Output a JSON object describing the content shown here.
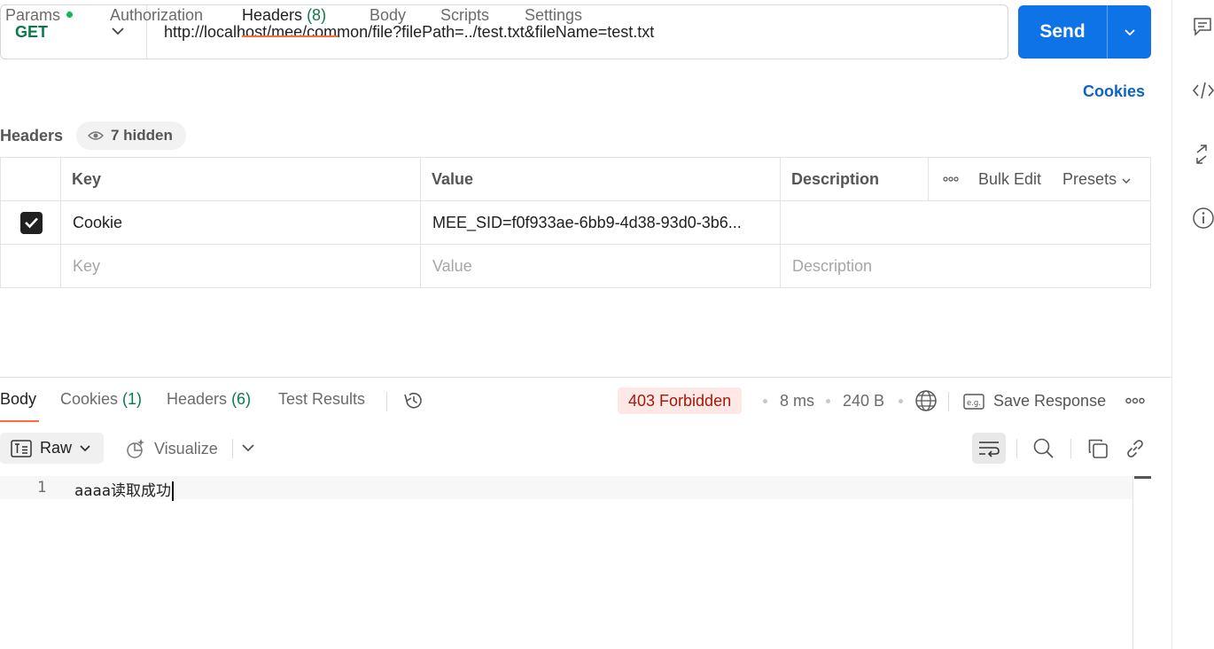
{
  "request": {
    "method": "GET",
    "url": "http://localhost/mee/common/file?filePath=../test.txt&fileName=test.txt",
    "send_label": "Send"
  },
  "request_tabs": [
    {
      "label": "Params",
      "count": ""
    },
    {
      "label": "Authorization",
      "count": ""
    },
    {
      "label": "Headers",
      "count": "(8)"
    },
    {
      "label": "Body",
      "count": ""
    },
    {
      "label": "Scripts",
      "count": ""
    },
    {
      "label": "Settings",
      "count": ""
    }
  ],
  "cookies_link": "Cookies",
  "headers_section": {
    "title": "Headers",
    "hidden_label": "7 hidden",
    "columns": {
      "key": "Key",
      "value": "Value",
      "description": "Description"
    },
    "bulk_edit": "Bulk Edit",
    "presets": "Presets",
    "rows": [
      {
        "checked": true,
        "key": "Cookie",
        "value": "MEE_SID=f0f933ae-6bb9-4d38-93d0-3b6...",
        "description": ""
      }
    ],
    "placeholder": {
      "key": "Key",
      "value": "Value",
      "description": "Description"
    }
  },
  "response_tabs": [
    {
      "label": "Body",
      "count": ""
    },
    {
      "label": "Cookies",
      "count": "(1)"
    },
    {
      "label": "Headers",
      "count": "(6)"
    },
    {
      "label": "Test Results",
      "count": ""
    }
  ],
  "response_meta": {
    "status": "403 Forbidden",
    "time": "8 ms",
    "size": "240 B",
    "save_label": "Save Response",
    "status_bg": "#fde8e6",
    "status_color": "#a11a0e"
  },
  "response_toolbar": {
    "format": "Raw",
    "visualize": "Visualize"
  },
  "response_body": {
    "lines": [
      {
        "number": "1",
        "text": "aaaa读取成功"
      }
    ]
  },
  "colors": {
    "accent": "#ff6c37",
    "send": "#0d73e6",
    "method": "#0b7a4b",
    "link": "#0d63c6"
  },
  "icons": [
    "chevron-down-icon",
    "eye-icon",
    "check-icon",
    "ellipsis-icon",
    "history-icon",
    "globe-icon",
    "eg-icon",
    "format-icon",
    "magic-wand-icon",
    "wrap-lines-icon",
    "search-icon",
    "copy-icon",
    "link-icon",
    "comment-icon",
    "code-icon",
    "expand-icon",
    "info-icon"
  ]
}
